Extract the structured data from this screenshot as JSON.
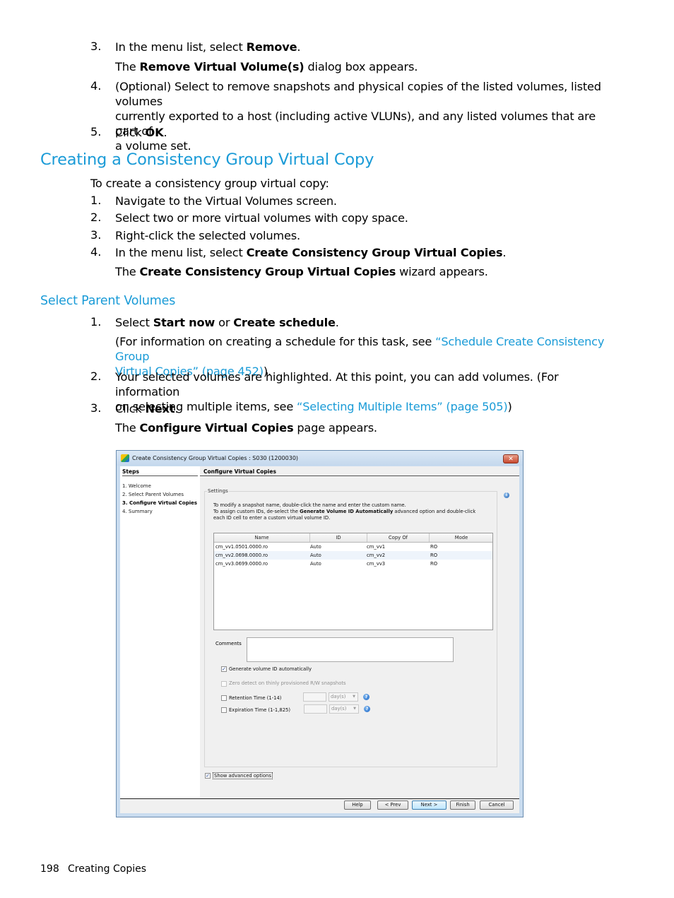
{
  "prev_steps": [
    {
      "num": "3.",
      "pre": "In the menu list, select ",
      "bold": "Remove",
      "post": "."
    },
    {
      "note_pre": "The ",
      "note_bold": "Remove Virtual Volume(s)",
      "note_post": " dialog box appears."
    },
    {
      "num": "4.",
      "line1": "(Optional) Select to remove snapshots and physical copies of the listed volumes, listed volumes",
      "line2": "currently exported to a host (including active VLUNs), and any listed volumes that are part of",
      "line3": "a volume set."
    },
    {
      "num": "5.",
      "pre": "Click ",
      "bold": "OK",
      "post": "."
    }
  ],
  "section": {
    "title": "Creating a Consistency Group Virtual Copy",
    "intro": "To create a consistency group virtual copy:",
    "steps": [
      {
        "num": "1.",
        "text": "Navigate to the Virtual Volumes screen."
      },
      {
        "num": "2.",
        "text": "Select two or more virtual volumes with copy space."
      },
      {
        "num": "3.",
        "text": "Right-click the selected volumes."
      },
      {
        "num": "4.",
        "pre": "In the menu list, select ",
        "bold": "Create Consistency Group Virtual Copies",
        "post": "."
      }
    ],
    "note": {
      "pre": "The ",
      "bold": "Create Consistency Group Virtual Copies",
      "post": " wizard appears."
    }
  },
  "subsection": {
    "title": "Select Parent Volumes",
    "step1": {
      "num": "1.",
      "pre": "Select ",
      "bold1": "Start now",
      "mid": " or ",
      "bold2": "Create schedule",
      "post": "."
    },
    "step1_note": {
      "pre": "(For information on creating a schedule for this task, see ",
      "link1": "“Schedule Create Consistency Group",
      "link2": "Virtual Copies” (page 452)",
      "post": ")."
    },
    "step2": {
      "num": "2.",
      "line1": "Your selected volumes are highlighted. At this point, you can add volumes. (For information",
      "pre2": "on selecting multiple items, see ",
      "link": "“Selecting Multiple Items” (page 505)",
      "post2": ")"
    },
    "step3": {
      "num": "3.",
      "pre": "Click ",
      "bold": "Next",
      "post": "."
    },
    "step3_note": {
      "pre": "The ",
      "bold": "Configure Virtual Copies",
      "post": " page appears."
    }
  },
  "dialog": {
    "title": "Create Consistency Group Virtual Copies : S030 (1200030)",
    "close_glyph": "✕",
    "steps_header": "Steps",
    "steps": [
      "1. Welcome",
      "2. Select Parent Volumes",
      "3. Configure Virtual Copies",
      "4. Summary"
    ],
    "active_step": 2,
    "page_header": "Configure Virtual Copies",
    "settings_label": "Settings",
    "info_glyph": "i",
    "desc1": "To modify a snapshot name, double-click the name and enter the custom name.",
    "desc2_pre": "To assign custom IDs, de-select the ",
    "desc2_bold": "Generate Volume ID Automatically",
    "desc2_post": " advanced option and double-click",
    "desc3": "each ID cell to enter a custom virtual volume ID.",
    "table": {
      "columns": [
        "Name",
        "ID",
        "Copy Of",
        "Mode"
      ],
      "rows": [
        [
          "cm_vv1.0501.0000.ro",
          "Auto",
          "cm_vv1",
          "RO"
        ],
        [
          "cm_vv2.0698.0000.ro",
          "Auto",
          "cm_vv2",
          "RO"
        ],
        [
          "cm_vv3.0699.0000.ro",
          "Auto",
          "cm_vv3",
          "RO"
        ]
      ]
    },
    "comments_label": "Comments",
    "comments_value": "",
    "options": {
      "generate_id": {
        "label": "Generate volume ID automatically",
        "checked": true
      },
      "zero_detect": {
        "label": "Zero detect on thinly provisioned R/W snapshots",
        "checked": false,
        "disabled": true
      },
      "retention": {
        "label": "Retention Time  (1-14)",
        "checked": false,
        "value": "",
        "unit": "day(s)"
      },
      "expiration": {
        "label": "Expiration Time  (1-1,825)",
        "checked": false,
        "value": "",
        "unit": "day(s)"
      }
    },
    "show_advanced": {
      "label": "Show advanced options",
      "checked": true
    },
    "check_glyph": "✓",
    "arrow_glyph": "▼",
    "help_glyph": "?",
    "buttons": {
      "help": "Help",
      "prev": "< Prev",
      "next": "Next >",
      "finish": "Finish",
      "cancel": "Cancel"
    }
  },
  "footer": {
    "page": "198",
    "chapter": "Creating Copies"
  },
  "colors": {
    "link": "#1a9bd7",
    "heading": "#1a9bd7"
  }
}
